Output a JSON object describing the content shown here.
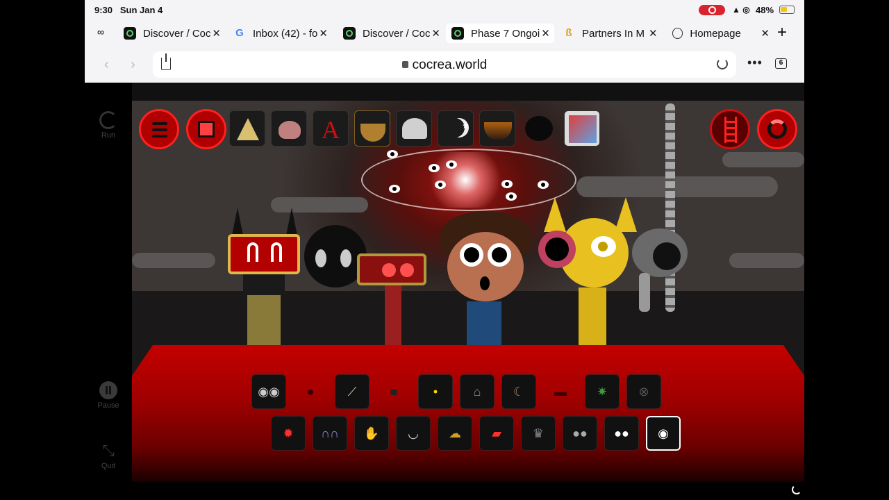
{
  "status": {
    "time": "9:30",
    "date": "Sun Jan 4",
    "battery": "48%"
  },
  "tabs": [
    {
      "title": "Discover / Coc",
      "favicon": "cocrea-icon",
      "active": false
    },
    {
      "title": "Inbox (42) - fo",
      "favicon": "google-icon",
      "active": false
    },
    {
      "title": "Discover / Coc",
      "favicon": "cocrea-icon",
      "active": false
    },
    {
      "title": "Phase 7 Ongoi",
      "favicon": "cocrea-icon",
      "active": true
    },
    {
      "title": "Partners In M",
      "favicon": "partner-icon",
      "active": false
    },
    {
      "title": "Homepage",
      "favicon": "globe-icon",
      "active": false
    }
  ],
  "google_letter": "G",
  "partner_letter": "ß",
  "tabs_count": "6",
  "url": "cocrea.world",
  "sidebar": {
    "run": "Run",
    "pause": "Pause",
    "quit": "Quit"
  },
  "toolbar": {
    "letter_icon": "A"
  },
  "colors": {
    "accent": "#d40000",
    "panel": "#b00000",
    "selected_border": "#ffffff"
  }
}
